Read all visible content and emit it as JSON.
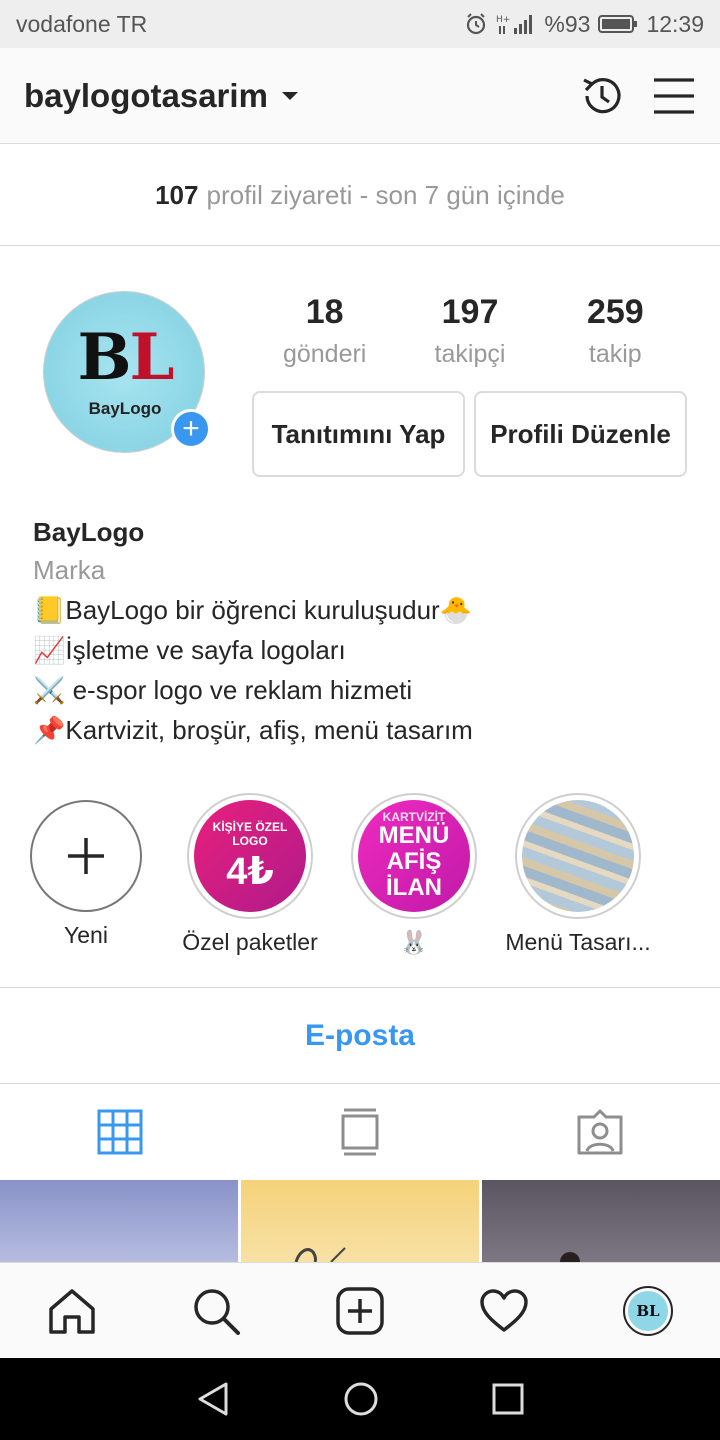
{
  "status_bar": {
    "carrier": "vodafone TR",
    "battery": "%93",
    "time": "12:39"
  },
  "header": {
    "username": "baylogotasarim",
    "icons": [
      "history-icon",
      "menu-icon"
    ]
  },
  "visits": {
    "count": "107",
    "text": "profil ziyareti - son 7 gün içinde"
  },
  "profile": {
    "avatar_letters": "BL",
    "avatar_caption": "BayLogo",
    "stats": [
      {
        "value": "18",
        "label": "gönderi"
      },
      {
        "value": "197",
        "label": "takipçi"
      },
      {
        "value": "259",
        "label": "takip"
      }
    ],
    "promote_label": "Tanıtımını Yap",
    "edit_label": "Profili Düzenle"
  },
  "bio": {
    "name": "BayLogo",
    "category": "Marka",
    "lines": [
      "📒BayLogo bir öğrenci kuruluşudur🐣",
      "📈İşletme ve sayfa logoları",
      "⚔️ e-spor logo ve reklam hizmeti",
      "📌Kartvizit, broşür, afiş, menü tasarım"
    ]
  },
  "highlights": [
    {
      "label": "Yeni",
      "art": []
    },
    {
      "label": "Özel paketler",
      "art": [
        "KİŞİYE ÖZEL LOGO",
        "4₺"
      ]
    },
    {
      "label": "🐰",
      "art": [
        "KARTVİZİT",
        "MENÜ",
        "AFİŞ",
        "İLAN"
      ]
    },
    {
      "label": "Menü Tasarı...",
      "art": []
    }
  ],
  "contact": {
    "email_label": "E-posta"
  },
  "tabs": [
    "grid-icon",
    "feed-icon",
    "tagged-icon"
  ],
  "bottom_nav": {
    "icons": [
      "home-icon",
      "search-icon",
      "new-post-icon",
      "activity-icon",
      "profile-avatar"
    ],
    "avatar_letters": "BL"
  },
  "colors": {
    "accent": "#3897f0",
    "text": "#262626",
    "muted": "#999999",
    "border": "#dbdbdb"
  }
}
